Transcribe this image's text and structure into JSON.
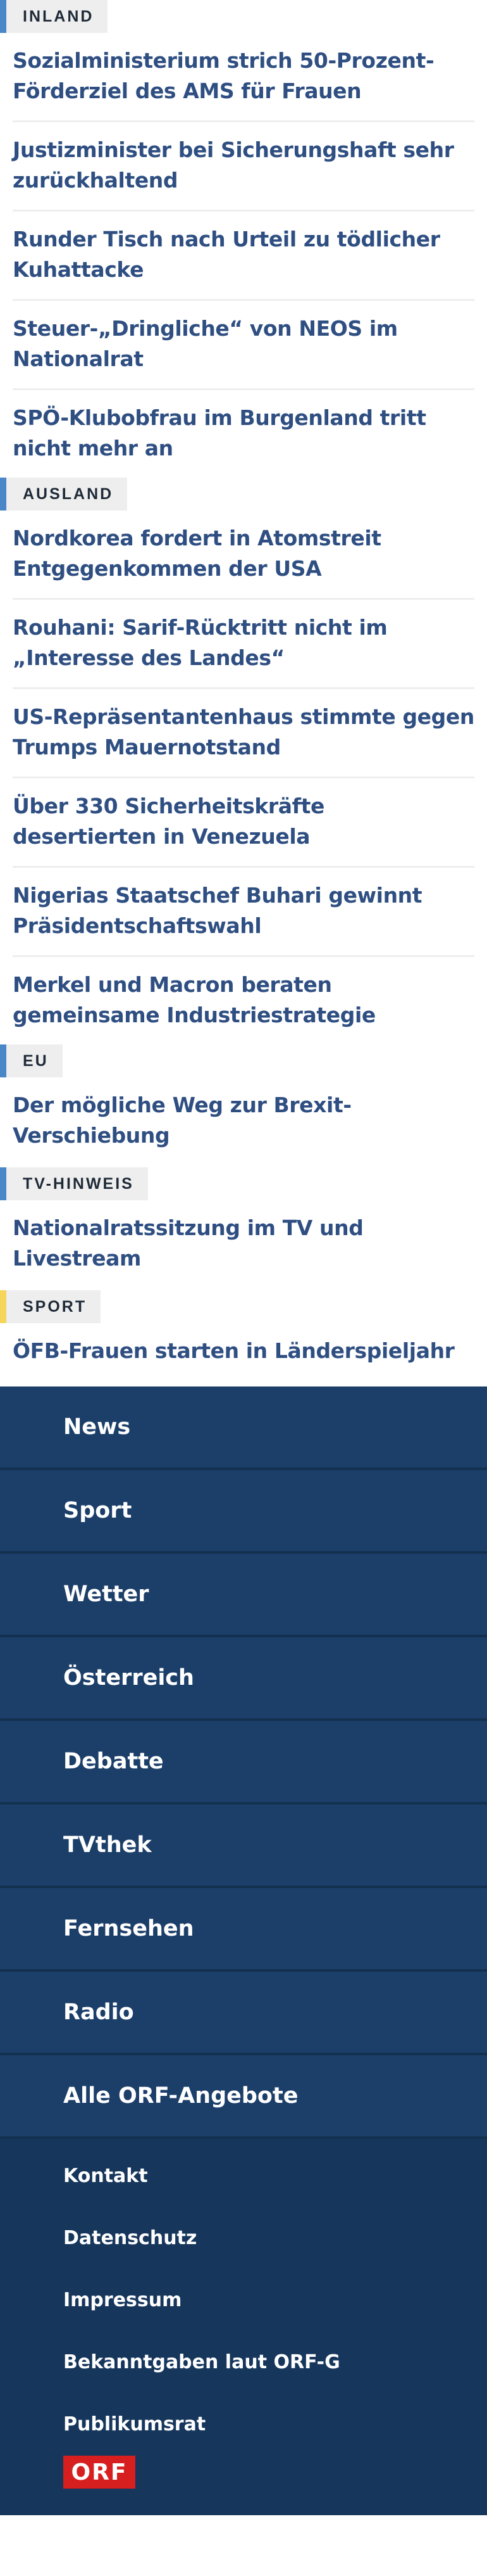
{
  "sections": {
    "inland": {
      "label": "INLAND",
      "stories": [
        "Sozialministerium strich 50-Prozent-Förderziel des AMS für Frauen",
        "Justizminister bei Sicherungshaft sehr zurückhaltend",
        "Runder Tisch nach Urteil zu tödlicher Kuhattacke",
        "Steuer-„Dringliche“ von NEOS im Nationalrat",
        "SPÖ-Klubobfrau im Burgenland tritt nicht mehr an"
      ]
    },
    "ausland": {
      "label": "AUSLAND",
      "stories": [
        "Nordkorea fordert in Atomstreit Entgegenkommen der USA",
        "Rouhani: Sarif-Rücktritt nicht im „Interesse des Landes“",
        "US-Repräsentantenhaus stimmte gegen Trumps Mauernotstand",
        "Über 330 Sicherheitskräfte desertierten in Venezuela",
        "Nigerias Staatschef Buhari gewinnt Präsidentschaftswahl",
        "Merkel und Macron beraten gemeinsame Industriestrategie"
      ]
    },
    "eu": {
      "label": "EU",
      "stories": [
        "Der mögliche Weg zur Brexit-Verschiebung"
      ]
    },
    "tv": {
      "label": "TV-HINWEIS",
      "stories": [
        "Nationalratssitzung im TV und Livestream"
      ]
    },
    "sport": {
      "label": "SPORT",
      "stories": [
        "ÖFB-Frauen starten in Länderspieljahr"
      ]
    }
  },
  "nav": {
    "main": [
      "News",
      "Sport",
      "Wetter",
      "Österreich",
      "Debatte",
      "TVthek",
      "Fernsehen",
      "Radio",
      "Alle ORF-Angebote"
    ],
    "sub": [
      "Kontakt",
      "Datenschutz",
      "Impressum",
      "Bekanntgaben laut ORF-G",
      "Publikumsrat"
    ],
    "logo": "ORF"
  },
  "colors": {
    "accent_blue": "#4a87c6",
    "sport_yellow": "#f5d65a",
    "headline": "#2f4f82",
    "nav_bg": "#1c3f6a",
    "logo_red": "#d71f1f"
  }
}
